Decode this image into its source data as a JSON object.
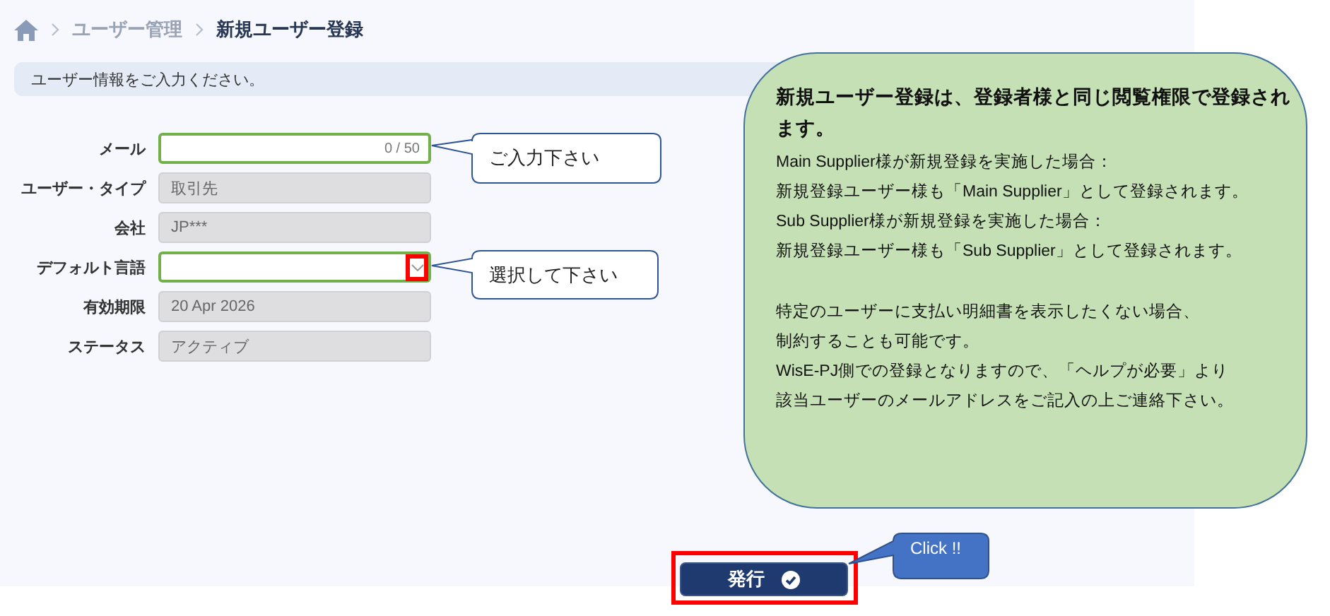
{
  "breadcrumb": {
    "items": [
      {
        "label": "ユーザー管理",
        "current": false
      },
      {
        "label": "新規ユーザー登録",
        "current": true
      }
    ]
  },
  "info_message": "ユーザー情報をご入力ください。",
  "form": {
    "fields": [
      {
        "label": "メール",
        "kind": "text",
        "disabled": false,
        "counter": "0 / 50"
      },
      {
        "label": "ユーザー・タイプ",
        "kind": "text",
        "disabled": true,
        "value": "取引先"
      },
      {
        "label": "会社",
        "kind": "text",
        "disabled": true,
        "value": "JP***"
      },
      {
        "label": "デフォルト言語",
        "kind": "select",
        "disabled": false,
        "highlighted": true
      },
      {
        "label": "有効期限",
        "kind": "text",
        "disabled": true,
        "value": "20 Apr 2026"
      },
      {
        "label": "ステータス",
        "kind": "text",
        "disabled": true,
        "value": "アクティブ"
      }
    ]
  },
  "submit_button": {
    "label": "発行",
    "highlighted": true
  },
  "callouts": [
    {
      "text": "ご入力下さい",
      "kind": "outline"
    },
    {
      "text": "選択して下さい",
      "kind": "outline"
    },
    {
      "text": "Click !!",
      "kind": "filled"
    }
  ],
  "note": {
    "title": "新規ユーザー登録は、登録者様と同じ閲覧権限で登録されます。",
    "paragraphs": [
      [
        "Main Supplier様が新規登録を実施した場合：",
        "新規登録ユーザー様も「Main Supplier」として登録されます。",
        "Sub Supplier様が新規登録を実施した場合：",
        "新規登録ユーザー様も「Sub Supplier」として登録されます。"
      ],
      [
        "特定のユーザーに支払い明細書を表示したくない場合、",
        "制約することも可能です。",
        "WisE-PJ側での登録となりますので、「ヘルプが必要」より",
        "該当ユーザーのメールアドレスをご記入の上ご連絡下さい。"
      ]
    ]
  }
}
